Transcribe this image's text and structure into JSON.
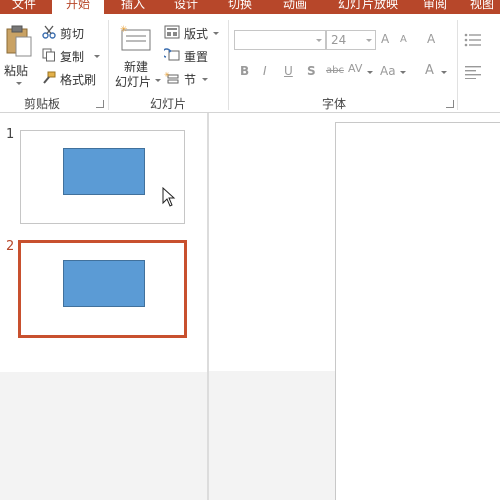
{
  "tabs": [
    {
      "label": "文件",
      "active": false
    },
    {
      "label": "开始",
      "active": true
    },
    {
      "label": "插入",
      "active": false
    },
    {
      "label": "设计",
      "active": false
    },
    {
      "label": "切换",
      "active": false
    },
    {
      "label": "动画",
      "active": false
    },
    {
      "label": "幻灯片放映",
      "active": false
    },
    {
      "label": "审阅",
      "active": false
    },
    {
      "label": "视图",
      "active": false
    }
  ],
  "clipboard": {
    "paste": "粘贴",
    "cut": "剪切",
    "copy": "复制",
    "format_painter": "格式刷",
    "group_label": "剪贴板"
  },
  "slides_group": {
    "new_slide_line1": "新建",
    "new_slide_line2": "幻灯片",
    "layout": "版式",
    "reset": "重置",
    "section": "节",
    "group_label": "幻灯片"
  },
  "font": {
    "font_name": "",
    "font_size": "24",
    "grow_icon": "A",
    "shrink_icon": "A",
    "clear_icon": "A",
    "bold": "B",
    "italic": "I",
    "underline": "U",
    "shadow": "S",
    "strike": "abc",
    "spacing": "AV",
    "case": "Aa",
    "color": "A",
    "group_label": "字体"
  },
  "slides": [
    {
      "number": "1",
      "selected": false
    },
    {
      "number": "2",
      "selected": true
    }
  ],
  "colors": {
    "accent": "#b7472a",
    "shape_fill": "#5b9bd5",
    "shape_border": "#41719c"
  }
}
